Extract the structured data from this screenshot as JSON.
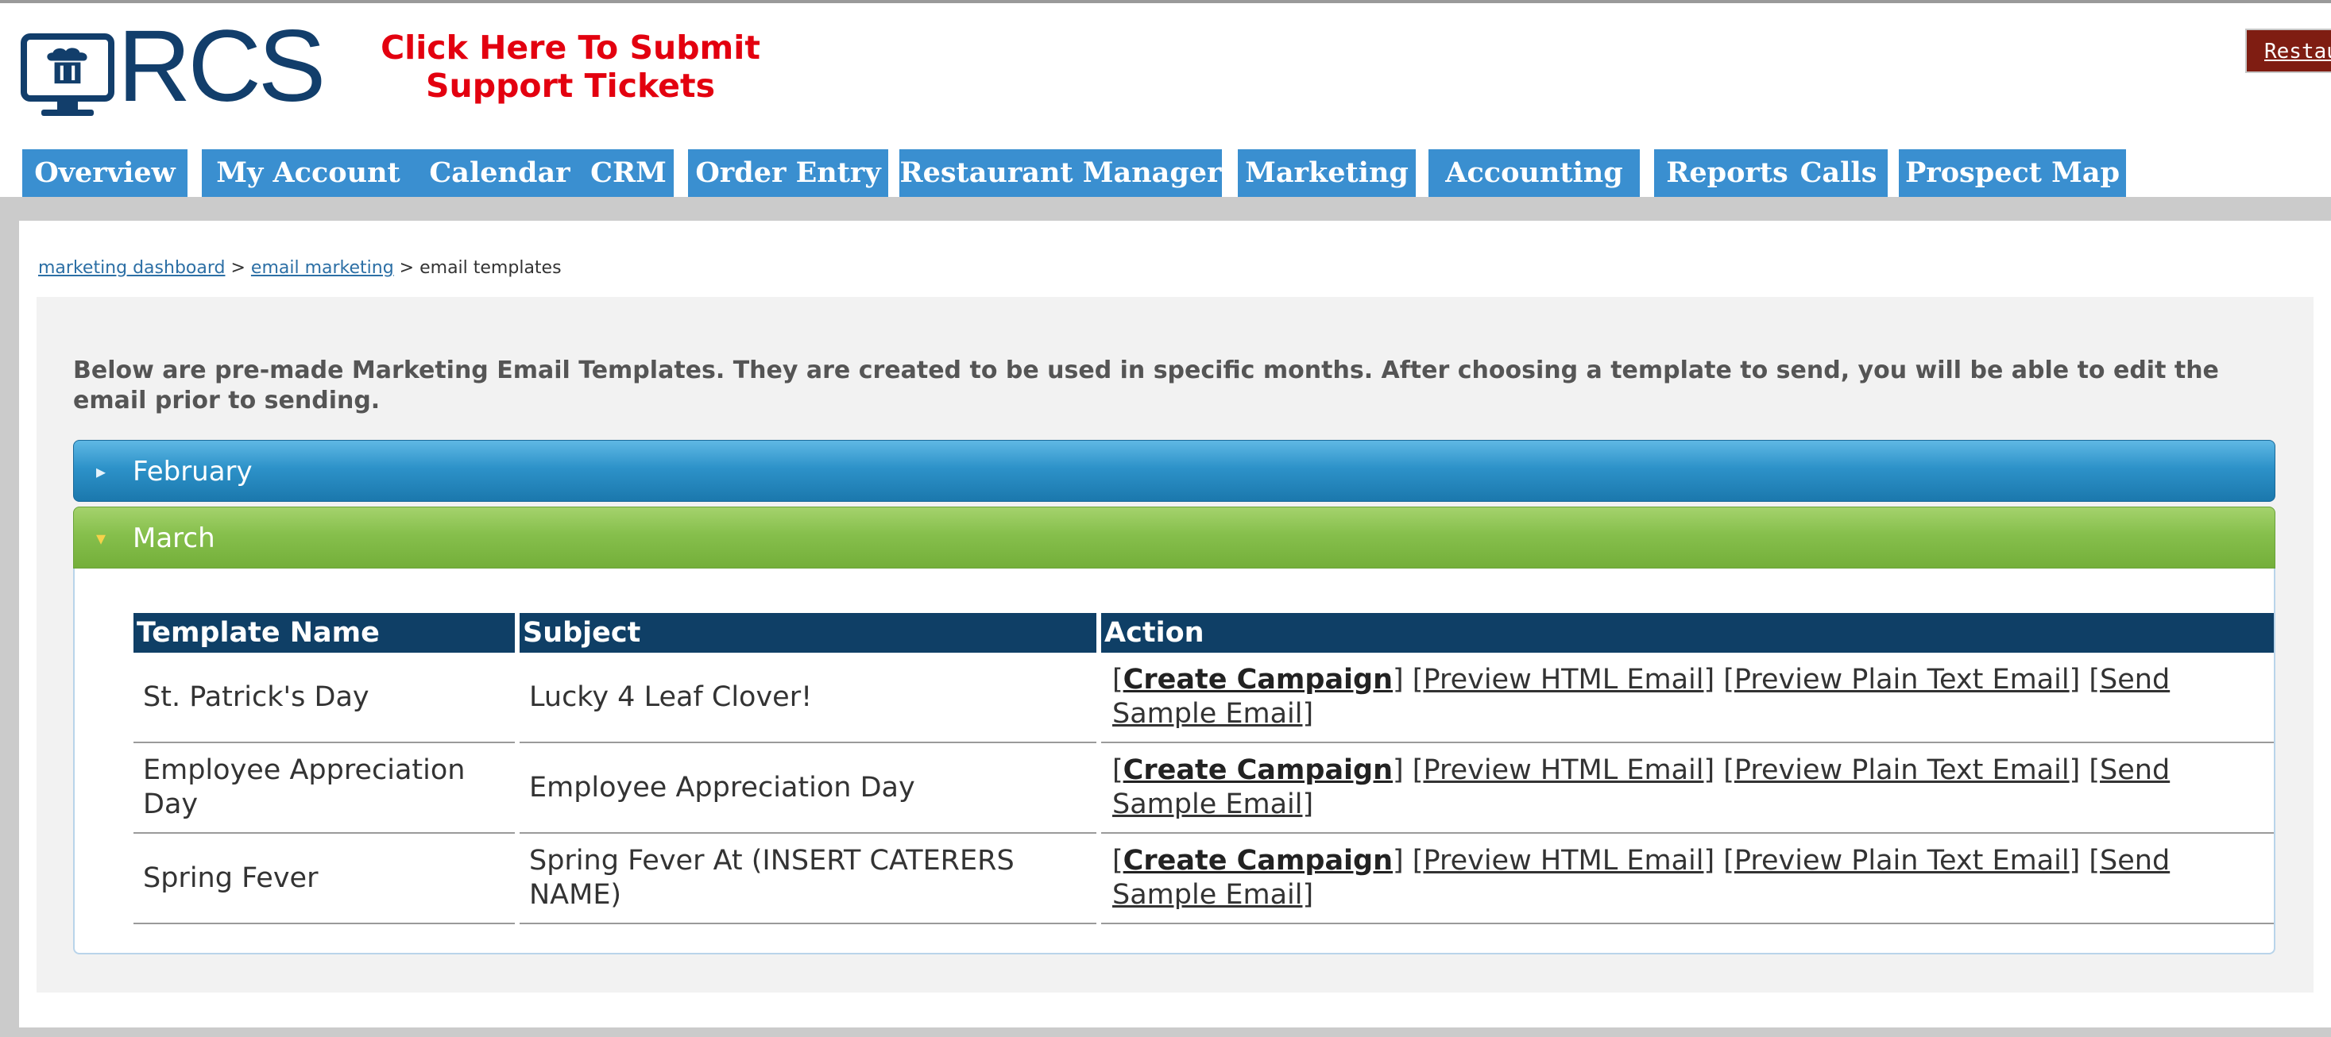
{
  "header": {
    "logo_text": "RCS",
    "support_link": "Click Here To Submit Support Tickets",
    "right_button": "Restaurant Manager"
  },
  "nav": {
    "tabs": [
      "Overview",
      "My Account",
      "Calendar",
      "CRM",
      "Order Entry",
      "Restaurant Manager",
      "Marketing",
      "Accounting",
      "Reports",
      "Calls",
      "Prospect Map"
    ]
  },
  "breadcrumb": {
    "items": [
      "marketing dashboard",
      "email marketing"
    ],
    "separator": ">",
    "current": "email templates"
  },
  "intro": "Below are pre-made Marketing Email Templates. They are created to be used in specific months. After choosing a template to send, you will be able to edit the email prior to sending.",
  "accordion": [
    {
      "label": "February",
      "expanded": false
    },
    {
      "label": "March",
      "expanded": true
    }
  ],
  "table": {
    "headers": [
      "Template Name",
      "Subject",
      "Action"
    ],
    "rows": [
      {
        "name": "St. Patrick's Day",
        "subject": "Lucky 4 Leaf Clover!"
      },
      {
        "name": "Employee Appreciation Day",
        "subject": "Employee Appreciation Day"
      },
      {
        "name": "Spring Fever",
        "subject": "Spring Fever At (INSERT CATERERS NAME)"
      }
    ],
    "actions": {
      "create": "Create Campaign",
      "preview_html": "Preview HTML Email",
      "preview_text": "Preview Plain Text Email",
      "send_sample": "Send Sample Email"
    }
  },
  "colors": {
    "brand_navy": "#123e6b",
    "support_red": "#e3000f",
    "nav_blue": "#3a8fd0",
    "table_header": "#0f3f66",
    "accordion_blue": "#2d92c9",
    "accordion_green": "#86bf4c"
  },
  "icons": {
    "logo": "chef-monitor-icon",
    "collapsed": "triangle-right-icon",
    "expanded": "triangle-down-icon"
  }
}
